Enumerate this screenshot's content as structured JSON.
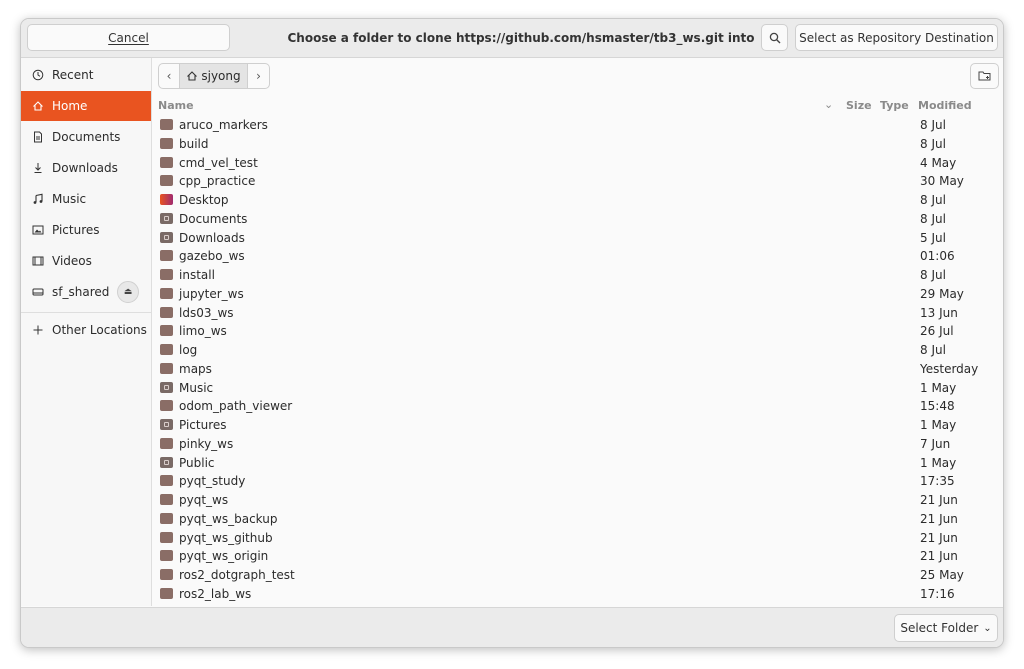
{
  "header": {
    "cancel_label": "Cancel",
    "title": "Choose a folder to clone https://github.com/hsmaster/tb3_ws.git into",
    "select_label": "Select as Repository Destination"
  },
  "sidebar": {
    "items": [
      {
        "label": "Recent",
        "icon": "clock-icon"
      },
      {
        "label": "Home",
        "icon": "home-icon",
        "active": true
      },
      {
        "label": "Documents",
        "icon": "document-icon"
      },
      {
        "label": "Downloads",
        "icon": "download-icon"
      },
      {
        "label": "Music",
        "icon": "music-icon"
      },
      {
        "label": "Pictures",
        "icon": "picture-icon"
      },
      {
        "label": "Videos",
        "icon": "video-icon"
      },
      {
        "label": "sf_shared",
        "icon": "drive-icon"
      },
      {
        "label": "Other Locations",
        "icon": "plus-icon"
      }
    ]
  },
  "pathbar": {
    "current": "sjyong"
  },
  "columns": {
    "name": "Name",
    "size": "Size",
    "type": "Type",
    "modified": "Modified"
  },
  "files": [
    {
      "name": "aruco_markers",
      "modified": "8 Jul"
    },
    {
      "name": "build",
      "modified": "8 Jul"
    },
    {
      "name": "cmd_vel_test",
      "modified": "4 May"
    },
    {
      "name": "cpp_practice",
      "modified": "30 May"
    },
    {
      "name": "Desktop",
      "modified": "8 Jul"
    },
    {
      "name": "Documents",
      "modified": "8 Jul"
    },
    {
      "name": "Downloads",
      "modified": "5 Jul"
    },
    {
      "name": "gazebo_ws",
      "modified": "01:06"
    },
    {
      "name": "install",
      "modified": "8 Jul"
    },
    {
      "name": "jupyter_ws",
      "modified": "29 May"
    },
    {
      "name": "lds03_ws",
      "modified": "13 Jun"
    },
    {
      "name": "limo_ws",
      "modified": "26 Jul"
    },
    {
      "name": "log",
      "modified": "8 Jul"
    },
    {
      "name": "maps",
      "modified": "Yesterday"
    },
    {
      "name": "Music",
      "modified": "1 May"
    },
    {
      "name": "odom_path_viewer",
      "modified": "15:48"
    },
    {
      "name": "Pictures",
      "modified": "1 May"
    },
    {
      "name": "pinky_ws",
      "modified": "7 Jun"
    },
    {
      "name": "Public",
      "modified": "1 May"
    },
    {
      "name": "pyqt_study",
      "modified": "17:35"
    },
    {
      "name": "pyqt_ws",
      "modified": "21 Jun"
    },
    {
      "name": "pyqt_ws_backup",
      "modified": "21 Jun"
    },
    {
      "name": "pyqt_ws_github",
      "modified": "21 Jun"
    },
    {
      "name": "pyqt_ws_origin",
      "modified": "21 Jun"
    },
    {
      "name": "ros2_dotgraph_test",
      "modified": "25 May"
    },
    {
      "name": "ros2_lab_ws",
      "modified": "17:16"
    }
  ],
  "footer": {
    "filter_label": "Select Folder"
  },
  "colors": {
    "accent": "#e95420",
    "folder": "#8a6d66"
  }
}
